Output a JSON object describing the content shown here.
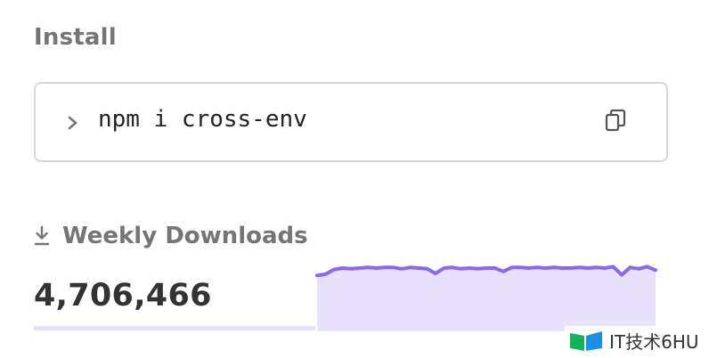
{
  "install": {
    "heading": "Install",
    "command": "npm i cross-env",
    "prompt_icon": "chevron-right-icon",
    "copy_icon": "copy-icon"
  },
  "downloads": {
    "heading": "Weekly Downloads",
    "icon": "download-icon",
    "count": "4,706,466",
    "sparkline": {
      "line_color": "#8966f4",
      "fill_color": "#e7e1fd",
      "values": [
        0.85,
        0.87,
        0.94,
        0.96,
        0.95,
        0.96,
        0.97,
        0.96,
        0.97,
        0.97,
        0.95,
        0.97,
        0.96,
        0.95,
        0.88,
        0.96,
        0.97,
        0.95,
        0.96,
        0.95,
        0.96,
        0.96,
        0.91,
        0.97,
        0.97,
        0.96,
        0.97,
        0.96,
        0.97,
        0.96,
        0.96,
        0.97,
        0.96,
        0.97,
        0.96,
        0.98,
        0.86,
        0.97,
        0.95,
        0.98,
        0.93
      ]
    }
  },
  "watermark": {
    "text": "IT技术6HU",
    "logo_colors": [
      "#12b35d",
      "#1a8fe3"
    ]
  }
}
